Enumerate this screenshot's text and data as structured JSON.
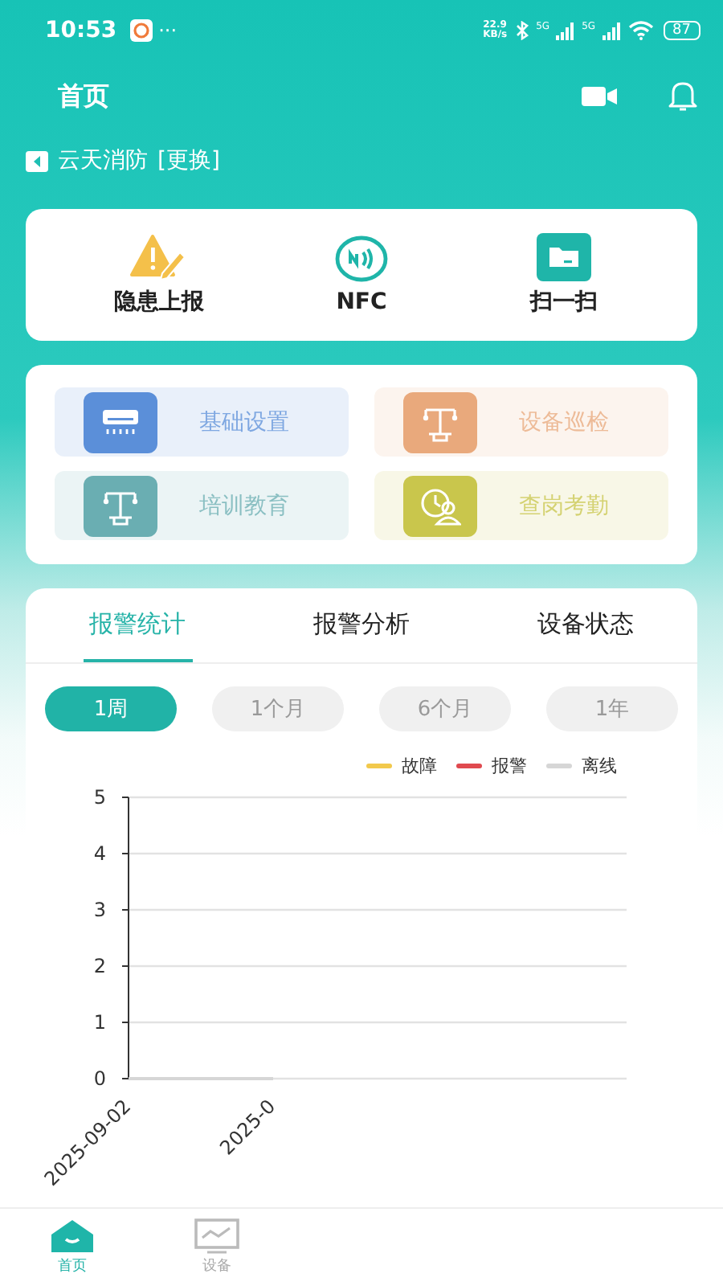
{
  "status_bar": {
    "time": "10:53",
    "more": "···",
    "speed_value": "22.9",
    "speed_unit": "KB/s",
    "network_labels": [
      "5G",
      "5G"
    ],
    "battery": "87"
  },
  "header": {
    "title": "首页"
  },
  "location": {
    "name": "云天消防",
    "action": "[更换]"
  },
  "quick_actions": [
    {
      "kind": "hazard",
      "label": "隐患上报"
    },
    {
      "kind": "nfc",
      "label": "NFC"
    },
    {
      "kind": "scan",
      "label": "扫一扫"
    }
  ],
  "features": [
    {
      "kind": "ac",
      "label": "基础设置",
      "color": "#5b8fd9"
    },
    {
      "kind": "lamp",
      "label": "设备巡检",
      "color": "#e9a97c"
    },
    {
      "kind": "lamp",
      "label": "培训教育",
      "color": "#6aaeb2"
    },
    {
      "kind": "people",
      "label": "查岗考勤",
      "color": "#c9c64c"
    }
  ],
  "tabs": [
    {
      "label": "报警统计",
      "selected": true
    },
    {
      "label": "报警分析",
      "selected": false
    },
    {
      "label": "设备状态",
      "selected": false
    }
  ],
  "periods": [
    {
      "label": "1周",
      "selected": true
    },
    {
      "label": "1个月",
      "selected": false
    },
    {
      "label": "6个月",
      "selected": false
    },
    {
      "label": "1年",
      "selected": false
    }
  ],
  "chart_data": {
    "type": "line",
    "categories": [
      "2025-09-02",
      "2025-0"
    ],
    "ylim": [
      0,
      5
    ],
    "yticks": [
      0,
      1,
      2,
      3,
      4,
      5
    ],
    "series": [
      {
        "name": "故障",
        "color": "#f2c94c",
        "values": [
          null,
          null
        ]
      },
      {
        "name": "报警",
        "color": "#e04a4f",
        "values": [
          null,
          null
        ]
      },
      {
        "name": "离线",
        "color": "#d6d6d6",
        "values": [
          0,
          0
        ]
      }
    ]
  },
  "bottom_nav": [
    {
      "kind": "home",
      "label": "首页",
      "selected": true
    },
    {
      "kind": "monitor",
      "label": "设备",
      "selected": false
    }
  ]
}
